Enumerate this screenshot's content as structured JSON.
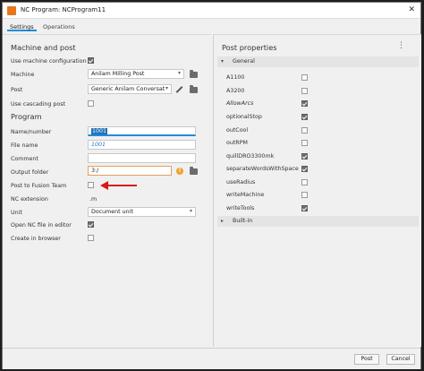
{
  "window": {
    "title": "NC Program: NCProgram11",
    "close_glyph": "✕"
  },
  "tabs": [
    {
      "label": "Settings",
      "active": true
    },
    {
      "label": "Operations",
      "active": false
    }
  ],
  "machine_and_post": {
    "heading": "Machine and post",
    "use_machine_configuration": {
      "label": "Use machine configuration",
      "checked": true
    },
    "machine": {
      "label": "Machine",
      "value": "Anilam Milling Post"
    },
    "post": {
      "label": "Post",
      "value": "Generic Anilam Conversat"
    },
    "use_cascading_post": {
      "label": "Use cascading post",
      "checked": false
    }
  },
  "program": {
    "heading": "Program",
    "name_number": {
      "label": "Name/number",
      "value": "1001"
    },
    "file_name": {
      "label": "File name",
      "value": "1001"
    },
    "comment": {
      "label": "Comment",
      "value": ""
    },
    "output_folder": {
      "label": "Output folder",
      "value": "3:/"
    },
    "post_to_fusion_team": {
      "label": "Post to Fusion Team",
      "checked": false
    },
    "nc_extension": {
      "label": "NC extension",
      "value": ".m"
    },
    "unit": {
      "label": "Unit",
      "value": "Document unit"
    },
    "open_nc_file_in_editor": {
      "label": "Open NC file in editor",
      "checked": true
    },
    "create_in_browser": {
      "label": "Create in browser",
      "checked": false
    }
  },
  "post_properties": {
    "heading": "Post properties",
    "groups": [
      {
        "label": "General",
        "expanded": true
      },
      {
        "label": "Built-in",
        "expanded": false
      }
    ],
    "items": [
      {
        "label": "A1100",
        "checked": false,
        "modified": false
      },
      {
        "label": "A3200",
        "checked": false,
        "modified": false
      },
      {
        "label": "AllowArcs",
        "checked": true,
        "modified": true
      },
      {
        "label": "optionalStop",
        "checked": true,
        "modified": false
      },
      {
        "label": "outCool",
        "checked": false,
        "modified": false
      },
      {
        "label": "outRPM",
        "checked": false,
        "modified": false
      },
      {
        "label": "quillDRO3300mk",
        "checked": true,
        "modified": false
      },
      {
        "label": "separateWordsWithSpace",
        "checked": true,
        "modified": false
      },
      {
        "label": "useRadius",
        "checked": false,
        "modified": false
      },
      {
        "label": "writeMachine",
        "checked": false,
        "modified": false
      },
      {
        "label": "writeTools",
        "checked": true,
        "modified": false
      }
    ]
  },
  "footer": {
    "post_label": "Post",
    "cancel_label": "Cancel"
  },
  "colors": {
    "accent": "#1f8cd6",
    "annotation_arrow": "#d81818",
    "warning": "#f0a030"
  },
  "icons": {
    "app": "nc-program-icon",
    "folder": "folder-icon",
    "edit": "pencil-icon",
    "warning": "info-icon",
    "menu": "kebab-menu-icon"
  }
}
